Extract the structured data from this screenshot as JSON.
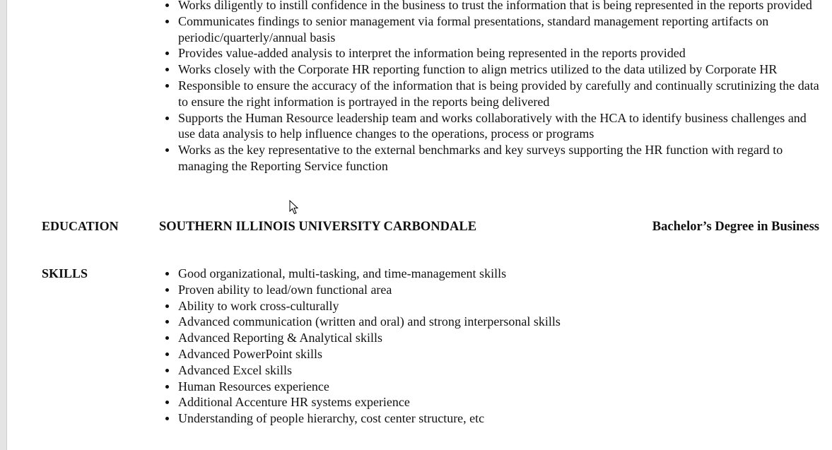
{
  "experience": {
    "responsibilities": [
      "Works diligently to instill confidence in the business to trust the information that is being represented in the reports provided",
      "Communicates findings to senior management via formal presentations, standard management reporting artifacts on periodic/quarterly/annual basis",
      "Provides value-added analysis to interpret the information being represented in the reports provided",
      "Works closely with the Corporate HR reporting function to align metrics utilized to the data utilized by Corporate HR",
      "Responsible to ensure the accuracy of the information that is being provided by carefully and continually scrutinizing the data to ensure the right information is portrayed in the reports being delivered",
      "Supports the Human Resource leadership team and works collaboratively with the HCA to identify business challenges and use data analysis to help influence changes to the operations, process or programs",
      "Works as the key representative to the external benchmarks and key surveys supporting the HR function with regard to managing the Reporting Service function"
    ]
  },
  "education": {
    "label": "EDUCATION",
    "school": "SOUTHERN ILLINOIS UNIVERSITY CARBONDALE",
    "degree": "Bachelor’s Degree in Business"
  },
  "skills": {
    "label": "SKILLS",
    "items": [
      "Good organizational, multi-tasking, and time-management skills",
      "Proven ability to lead/own functional area",
      "Ability to work cross-culturally",
      "Advanced communication (written and oral) and strong interpersonal skills",
      "Advanced Reporting & Analytical skills",
      "Advanced PowerPoint skills",
      "Advanced Excel skills",
      "Human Resources experience",
      "Additional Accenture HR systems experience",
      "Understanding of people hierarchy, cost center structure, etc"
    ]
  },
  "icons": {
    "cursor": "mouse-pointer-icon"
  }
}
